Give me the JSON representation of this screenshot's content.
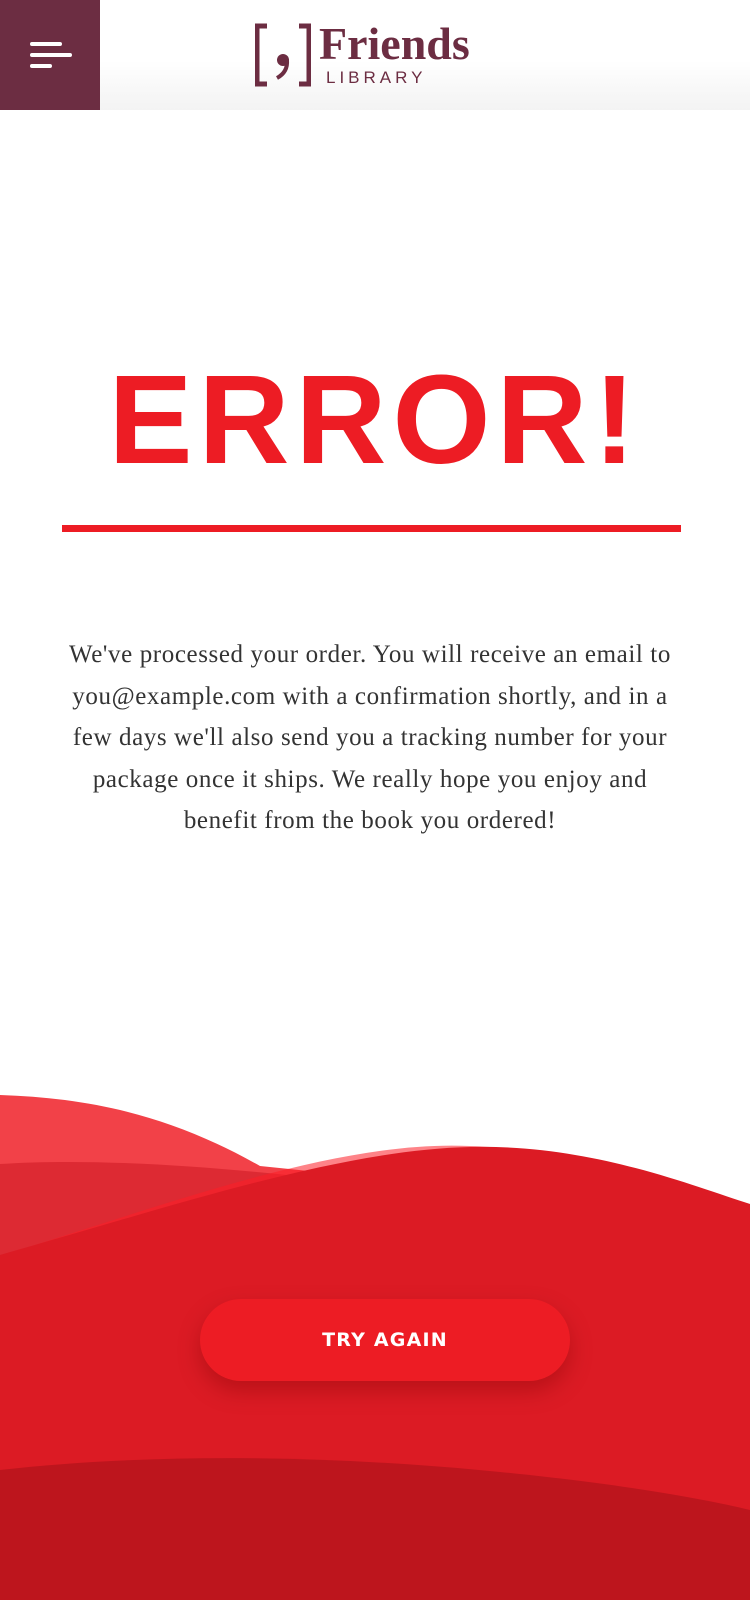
{
  "header": {
    "menu_icon": "hamburger-menu-icon",
    "logo_word": "Friends",
    "logo_sub": "LIBRARY",
    "brand_color": "#6c2d42"
  },
  "main": {
    "title": "ERROR!",
    "message": "We've processed your order. You will receive an email to you@example.com with a confirmation shortly, and in a few days we'll also send you a tracking number for your package once it ships. We really hope you enjoy and benefit from the book you ordered!",
    "accent_color": "#ed1c24"
  },
  "footer": {
    "button_label": "TRY AGAIN"
  }
}
